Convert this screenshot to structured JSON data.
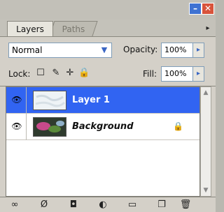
{
  "window": {
    "minimize_symbol": "–",
    "close_symbol": "✕"
  },
  "tabs": [
    {
      "label": "Layers",
      "active": true
    },
    {
      "label": "Paths",
      "active": false
    }
  ],
  "panel_menu_icon": "flyout-menu-icon",
  "blend": {
    "mode": "Normal",
    "opacity_label": "Opacity:",
    "opacity_value": "100%"
  },
  "lock": {
    "label": "Lock:",
    "icons": [
      "lock-transparent-icon",
      "lock-image-icon",
      "lock-position-icon",
      "lock-all-icon"
    ],
    "fill_label": "Fill:",
    "fill_value": "100%"
  },
  "layers": [
    {
      "name": "Layer 1",
      "selected": true,
      "visible": true,
      "locked": false
    },
    {
      "name": "Background",
      "selected": false,
      "visible": true,
      "locked": true
    }
  ],
  "bottom_toolbar": {
    "icons": [
      "link-icon",
      "layer-style-icon",
      "add-mask-icon",
      "adjustment-layer-icon",
      "new-group-icon",
      "new-layer-icon",
      "trash-icon"
    ]
  },
  "colors": {
    "selection": "#3164f2",
    "panel": "#d4d0c8",
    "close_button": "#d8533b",
    "minimize_button": "#3e72d2"
  }
}
